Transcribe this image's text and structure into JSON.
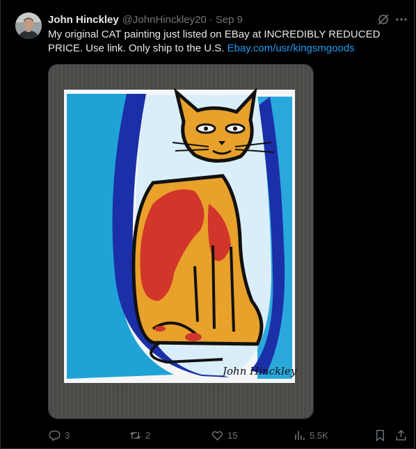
{
  "post": {
    "author_name": "John Hinckley",
    "author_handle": "@JohnHinckley20",
    "separator": "·",
    "date": "Sep 9",
    "text_part1": "My original CAT painting just listed on EBay at INCREDIBLY REDUCED PRICE. Use link. Only ship to the U.S. ",
    "link_text": "Ebay.com/usr/kingsmgoods",
    "media_signature": "John Hinckley"
  },
  "actions": {
    "replies": "3",
    "reposts": "2",
    "likes": "15",
    "views": "5.5K"
  },
  "icons": {
    "grok": "grok-icon",
    "more": "more-dots-icon",
    "reply": "reply-icon",
    "repost": "repost-icon",
    "like": "heart-icon",
    "views": "views-bar-chart-icon",
    "bookmark": "bookmark-icon",
    "share": "share-icon"
  },
  "colors": {
    "background": "#000000",
    "text": "#e7e9ea",
    "muted": "#71767b",
    "link": "#1d9bf0"
  }
}
